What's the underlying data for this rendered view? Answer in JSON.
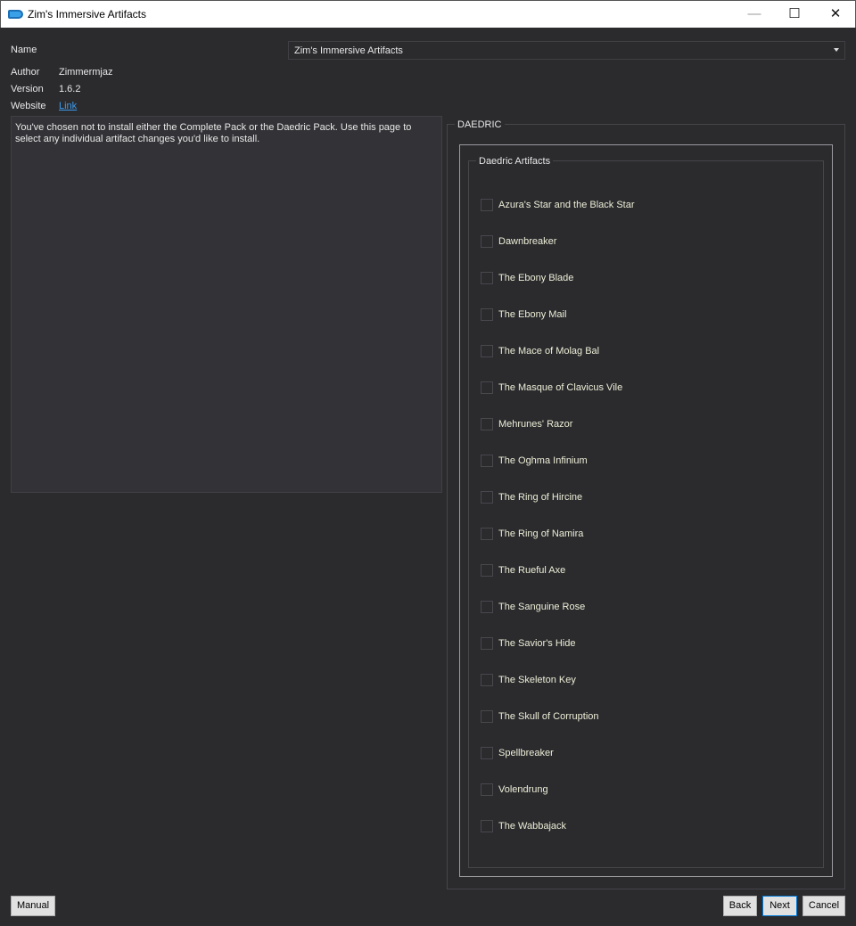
{
  "window": {
    "title": "Zim's Immersive Artifacts",
    "minimize": "—",
    "maximize": "☐",
    "close": "✕"
  },
  "info": {
    "name_label": "Name",
    "name_value": "Zim's Immersive Artifacts",
    "author_label": "Author",
    "author": "Zimmermjaz",
    "version_label": "Version",
    "version": "1.6.2",
    "website_label": "Website",
    "website_link": "Link"
  },
  "description": "You've chosen not to install either the Complete Pack or the Daedric Pack. Use this page to select any individual artifact changes you'd like to install.",
  "group": {
    "title": "DAEDRIC",
    "subgroup": "Daedric Artifacts"
  },
  "items": [
    {
      "label": "Azura's Star and the Black Star",
      "checked": false
    },
    {
      "label": "Dawnbreaker",
      "checked": false
    },
    {
      "label": "The Ebony Blade",
      "checked": false
    },
    {
      "label": "The Ebony Mail",
      "checked": false
    },
    {
      "label": "The Mace of Molag Bal",
      "checked": false
    },
    {
      "label": "The Masque of Clavicus Vile",
      "checked": false
    },
    {
      "label": "Mehrunes' Razor",
      "checked": false
    },
    {
      "label": "The Oghma Infinium",
      "checked": false
    },
    {
      "label": "The Ring of Hircine",
      "checked": false
    },
    {
      "label": "The Ring of Namira",
      "checked": false
    },
    {
      "label": "The Rueful Axe",
      "checked": false
    },
    {
      "label": "The Sanguine Rose",
      "checked": false
    },
    {
      "label": "The Savior's Hide",
      "checked": false
    },
    {
      "label": "The Skeleton Key",
      "checked": false
    },
    {
      "label": "The Skull of Corruption",
      "checked": false
    },
    {
      "label": "Spellbreaker",
      "checked": false
    },
    {
      "label": "Volendrung",
      "checked": false
    },
    {
      "label": "The Wabbajack",
      "checked": false
    }
  ],
  "buttons": {
    "manual": "Manual",
    "back": "Back",
    "next": "Next",
    "cancel": "Cancel"
  }
}
